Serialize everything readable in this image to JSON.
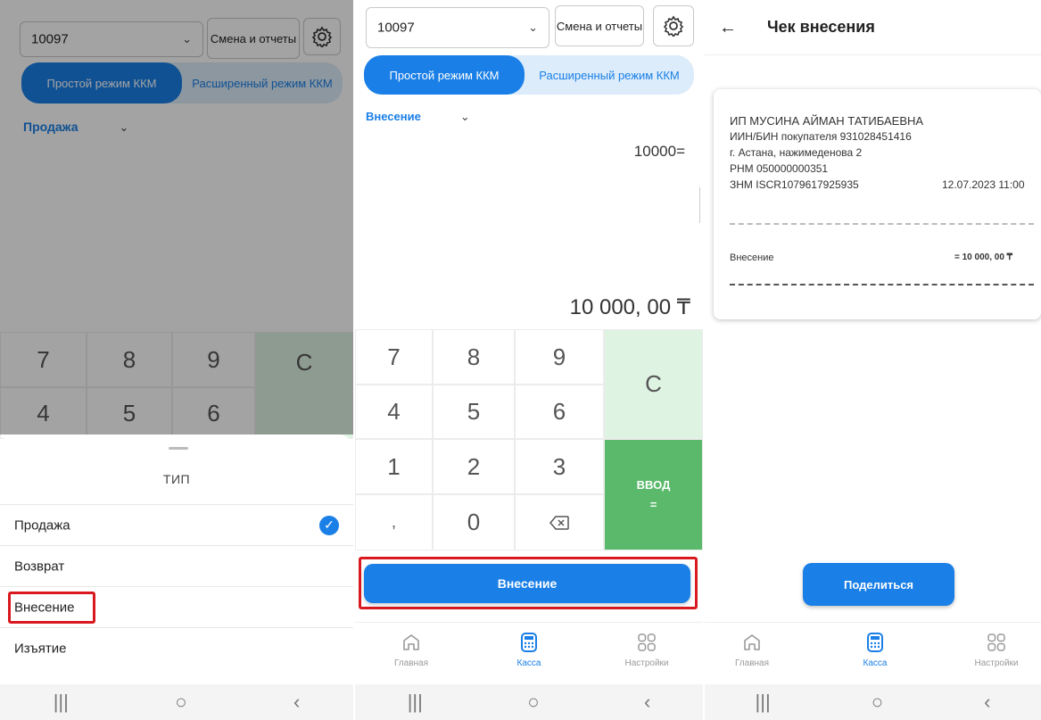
{
  "panel1": {
    "terminal_select": "10097",
    "shift_button": "Смена и отчеты",
    "mode_simple": "Простой режим ККМ",
    "mode_extended": "Расширенный режим ККМ",
    "type_selected": "Продажа",
    "keys": [
      "7",
      "8",
      "9",
      "C",
      "4",
      "5",
      "6"
    ],
    "sheet": {
      "title": "ТИП",
      "options": [
        {
          "label": "Продажа",
          "checked": true
        },
        {
          "label": "Возврат",
          "checked": false
        },
        {
          "label": "Внесение",
          "checked": false,
          "highlighted": true
        },
        {
          "label": "Изъятие",
          "checked": false
        }
      ]
    }
  },
  "panel2": {
    "terminal_select": "10097",
    "shift_button": "Смена и отчеты",
    "mode_simple": "Простой режим ККМ",
    "mode_extended": "Расширенный режим ККМ",
    "type_selected": "Внесение",
    "entry": "10000=",
    "amount": "10 000, 00 ₸",
    "keys": {
      "k7": "7",
      "k8": "8",
      "k9": "9",
      "k4": "4",
      "k5": "5",
      "k6": "6",
      "k1": "1",
      "k2": "2",
      "k3": "3",
      "comma": ",",
      "k0": "0",
      "clear": "C",
      "enter_label": "ВВОД",
      "enter_sign": "="
    },
    "submit_button": "Внесение",
    "tabs": {
      "home": "Главная",
      "cash": "Касса",
      "settings": "Настройки"
    }
  },
  "panel3": {
    "title": "Чек внесения",
    "receipt": {
      "seller": "ИП МУСИНА АЙМАН ТАТИБАЕВНА",
      "buyer_iin": "ИИН/БИН покупателя 931028451416",
      "address": "г. Астана, нажимеденова 2",
      "rnm": "РНМ 050000000351",
      "znm": "ЗНМ ISCR1079617925935",
      "datetime": "12.07.2023 11:00",
      "operation": "Внесение",
      "operation_amount": "= 10 000, 00 ₸"
    },
    "share_button": "Поделиться",
    "tabs": {
      "home": "Главная",
      "cash": "Касса",
      "settings": "Настройки"
    }
  },
  "system_nav": {
    "recents": "|||",
    "home": "○",
    "back": "‹"
  },
  "colors": {
    "accent": "#1a7fe6",
    "enter_key": "#5bb96c",
    "clear_key": "#dff3e3",
    "highlight": "#d9191f"
  }
}
